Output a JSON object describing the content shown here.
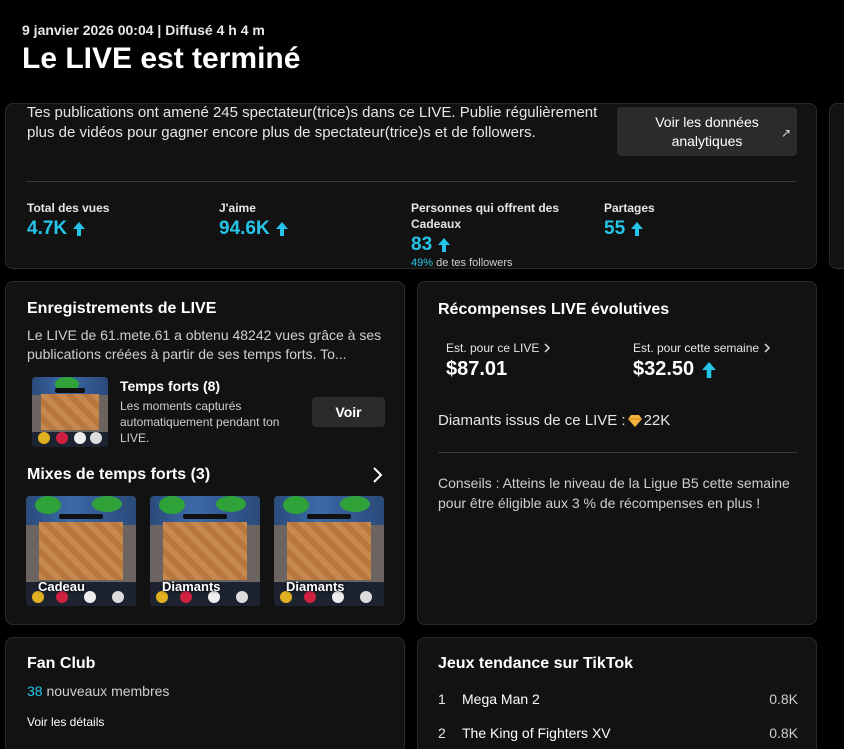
{
  "header": {
    "meta": "9 janvier 2026 00:04 | Diffusé 4 h 4 m",
    "title": "Le LIVE est terminé"
  },
  "summary": {
    "text": "Tes publications ont amené 245 spectateur(trice)s dans ce LIVE. Publie régulièrement plus de vidéos pour gagner encore plus de spectateur(trice)s et de followers.",
    "analytics_button": "Voir les données analytiques",
    "stats": [
      {
        "label": "Total des vues",
        "value": "4.7K"
      },
      {
        "label": "J'aime",
        "value": "94.6K"
      },
      {
        "label": "Personnes qui offrent des Cadeaux",
        "value": "83",
        "sub_pct": "49%",
        "sub_text": " de tes followers"
      },
      {
        "label": "Partages",
        "value": "55"
      }
    ]
  },
  "recordings": {
    "title": "Enregistrements de LIVE",
    "description": "Le LIVE de 61.mete.61 a obtenu 48242 vues grâce à ses publications créées à partir de ses temps forts. To...",
    "item_title": "Temps forts (8)",
    "item_desc": "Les moments capturés automatiquement pendant ton LIVE.",
    "voir_label": "Voir",
    "mixes_title": "Mixes de temps forts (3)",
    "mixes": [
      {
        "label": "Cadeau"
      },
      {
        "label": "Diamants"
      },
      {
        "label": "Diamants"
      }
    ]
  },
  "rewards": {
    "title": "Récompenses LIVE évolutives",
    "est_live_label": "Est. pour ce LIVE",
    "est_live_value": "$87.01",
    "est_week_label": "Est. pour cette semaine",
    "est_week_value": "$32.50",
    "diamonds_label": "Diamants issus de ce LIVE :",
    "diamonds_value": "22K",
    "tip": "Conseils : Atteins le niveau de la Ligue B5 cette semaine pour être éligible aux 3 % de récompenses en plus !"
  },
  "fanclub": {
    "title": "Fan Club",
    "count": "38",
    "members_text": " nouveaux membres",
    "details_link": "Voir les détails"
  },
  "games": {
    "title": "Jeux tendance sur TikTok",
    "items": [
      {
        "rank": "1",
        "name": "Mega Man 2",
        "count": "0.8K"
      },
      {
        "rank": "2",
        "name": "The King of Fighters XV",
        "count": "0.8K"
      }
    ]
  },
  "colors": {
    "accent": "#24c5e8",
    "card_bg": "#121212",
    "button_bg": "#2b2b2b"
  }
}
